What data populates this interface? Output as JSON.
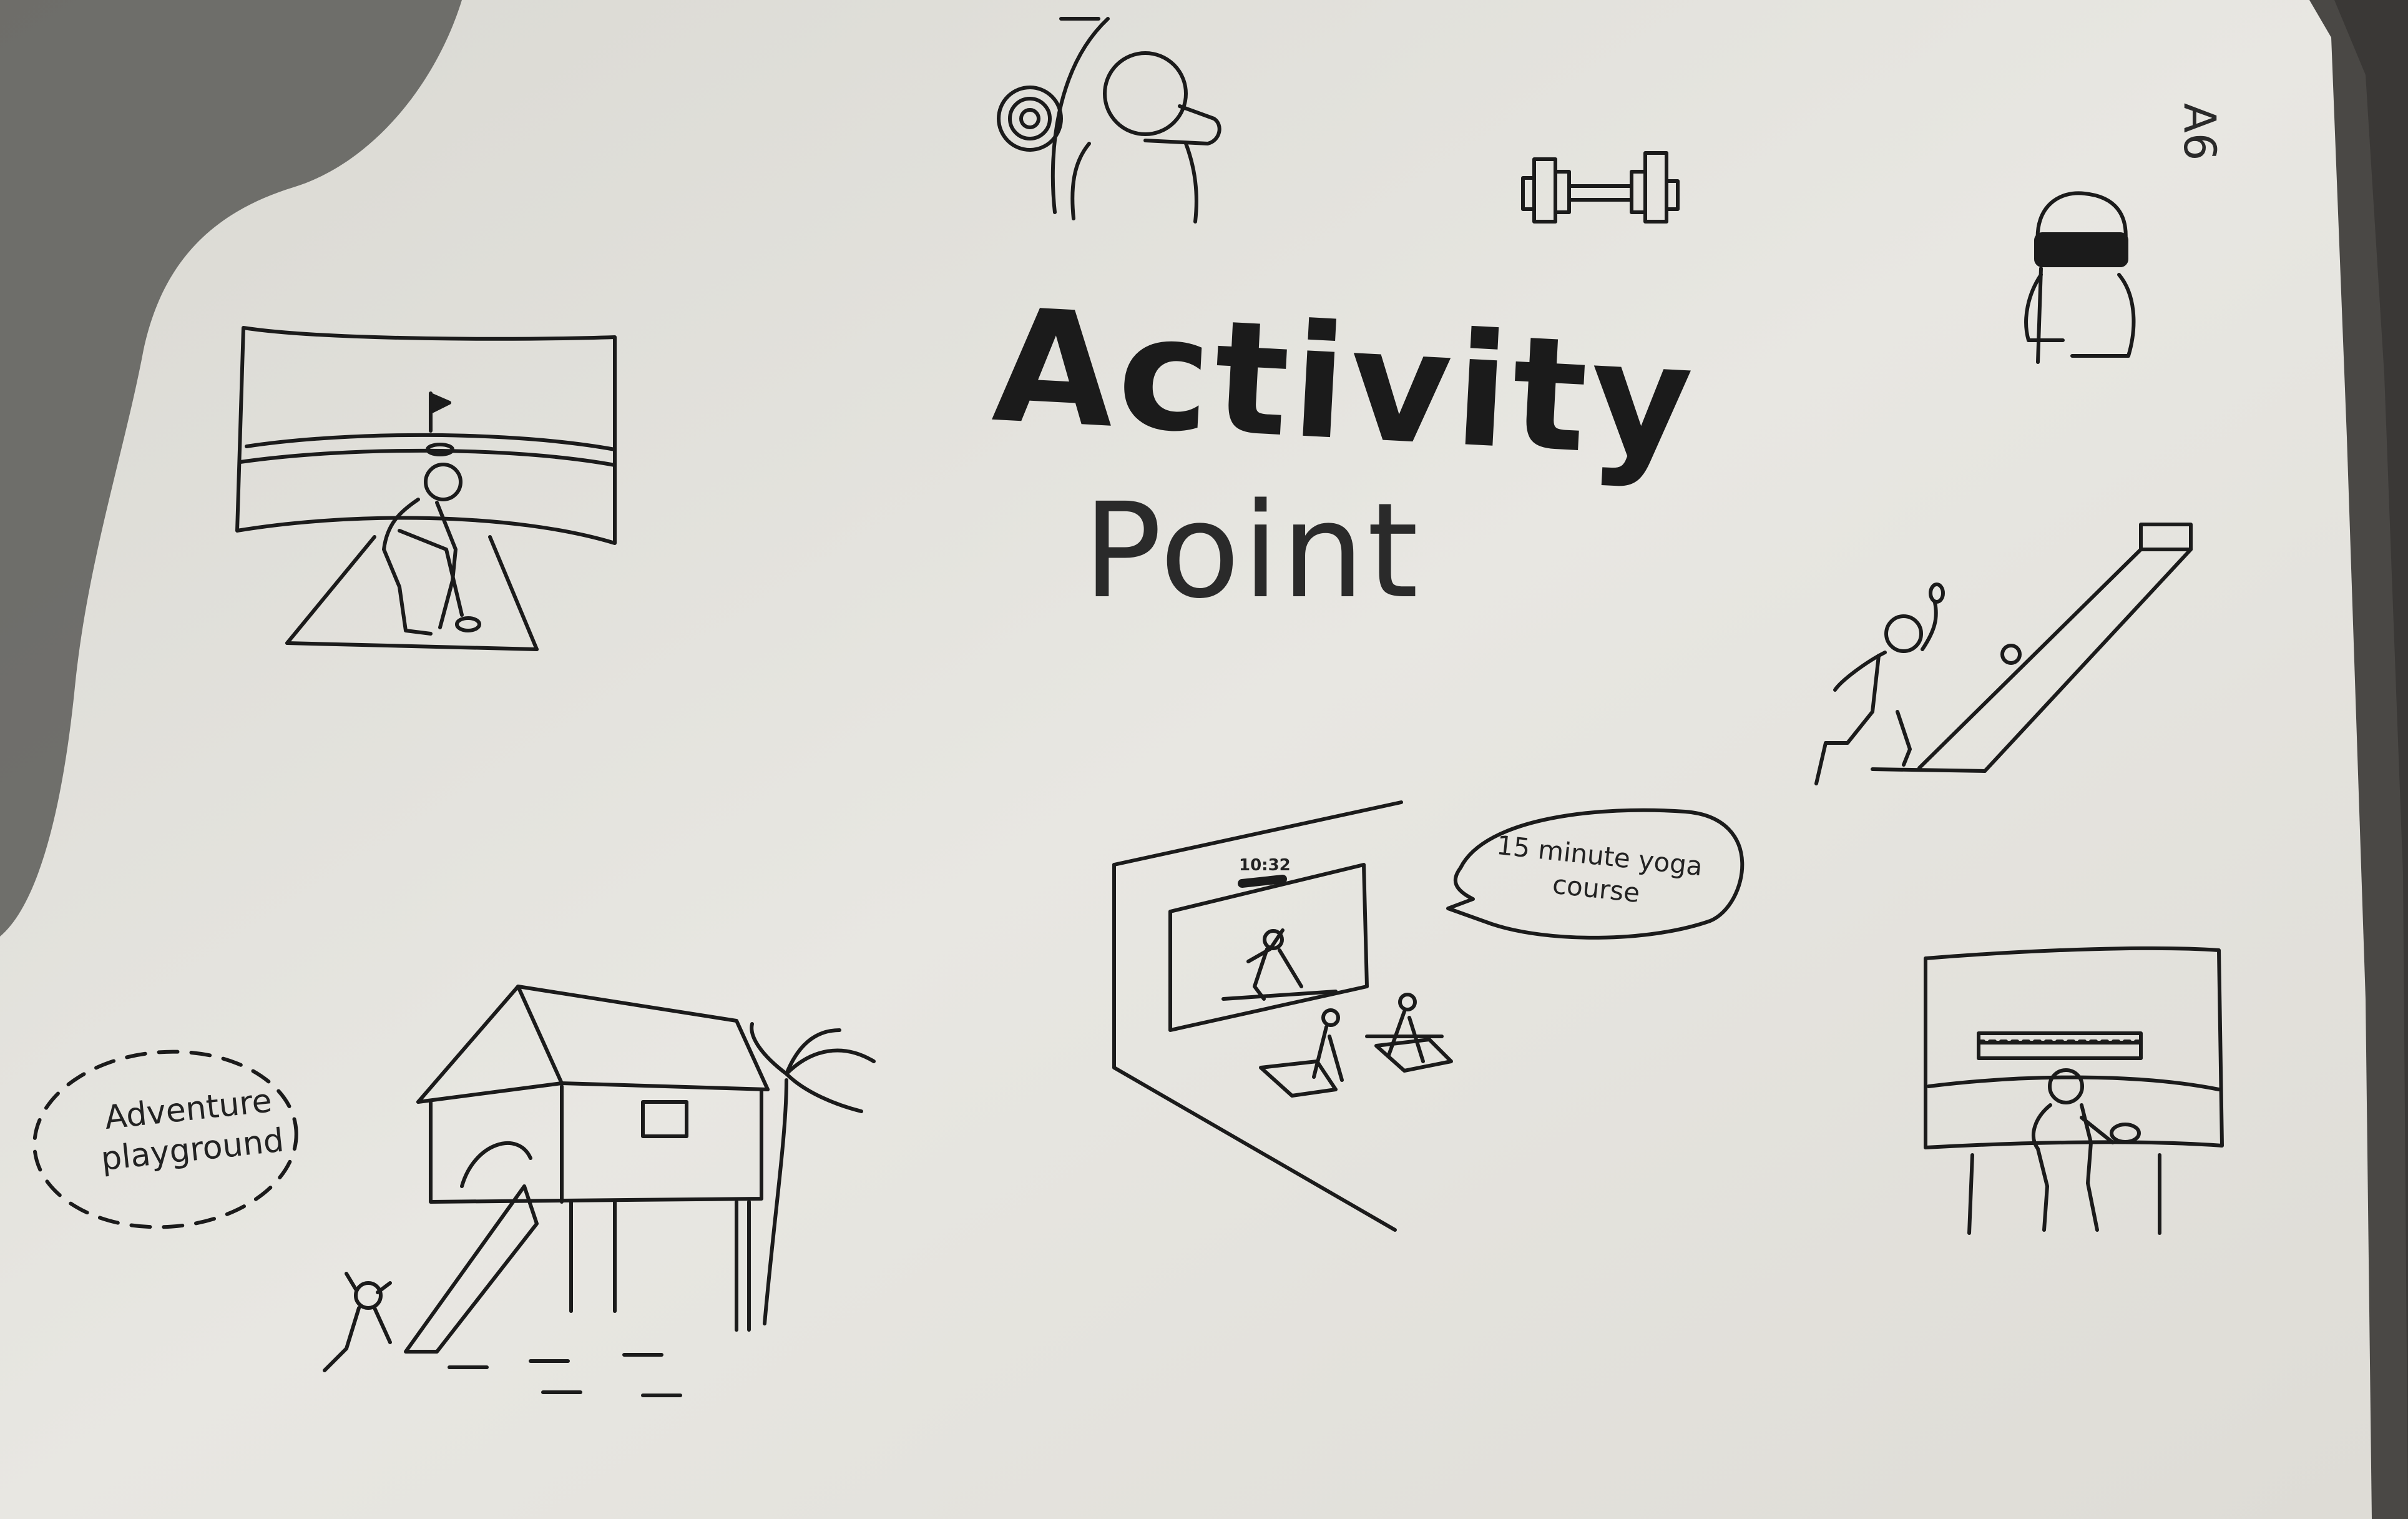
{
  "title": "Activity",
  "subtitle": "Point",
  "page_mark": "A6",
  "speech_bubble": "15 minute yoga course",
  "adventure_label": "Adventure playground",
  "clock_display": "10:32",
  "colors": {
    "paper": "#e6e5e0",
    "ink": "#1b1b1b",
    "shadow": "#5b5a57",
    "background": "#3a3836"
  },
  "icons": [
    "archery-target-icon",
    "dumbbell-icon",
    "vr-headset-icon",
    "golf-simulator-icon",
    "bowling-lane-icon",
    "yoga-studio-icon",
    "tennis-simulator-icon",
    "treehouse-slide-icon"
  ]
}
